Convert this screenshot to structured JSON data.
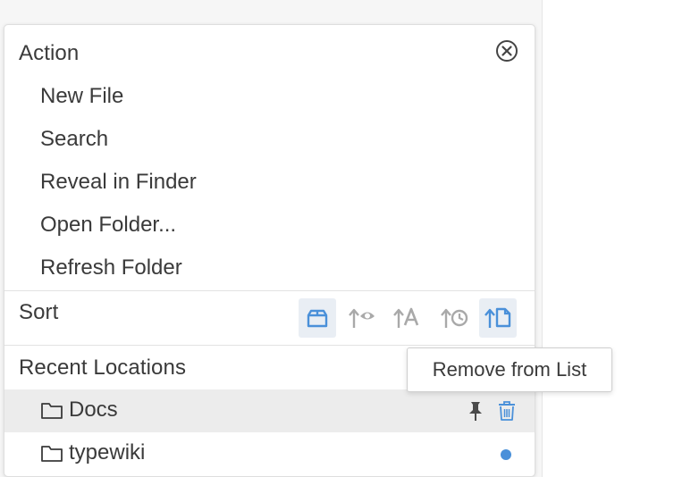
{
  "action": {
    "title": "Action",
    "items": [
      {
        "label": "New File"
      },
      {
        "label": "Search"
      },
      {
        "label": "Reveal in Finder"
      },
      {
        "label": "Open Folder..."
      },
      {
        "label": "Refresh Folder"
      }
    ]
  },
  "sort": {
    "title": "Sort",
    "buttons": [
      {
        "icon": "box-icon",
        "active": true
      },
      {
        "icon": "sort-by-views-icon",
        "active": false
      },
      {
        "icon": "sort-alphabetical-icon",
        "active": false
      },
      {
        "icon": "sort-by-time-icon",
        "active": false
      },
      {
        "icon": "sort-by-file-icon",
        "active": true
      }
    ]
  },
  "recent": {
    "title": "Recent Locations",
    "locations": [
      {
        "name": "Docs",
        "icon": "folder-icon",
        "actions": [
          "pin-icon",
          "trash-icon"
        ]
      },
      {
        "name": "typewiki",
        "icon": "folder-icon",
        "indicator": "dot-indicator"
      }
    ]
  },
  "tooltip": {
    "text": "Remove from List"
  },
  "colors": {
    "accent": "#4a90d9",
    "icon_gray": "#a9a9a9",
    "text": "#3a3a3a",
    "hover_row": "#ececec"
  }
}
